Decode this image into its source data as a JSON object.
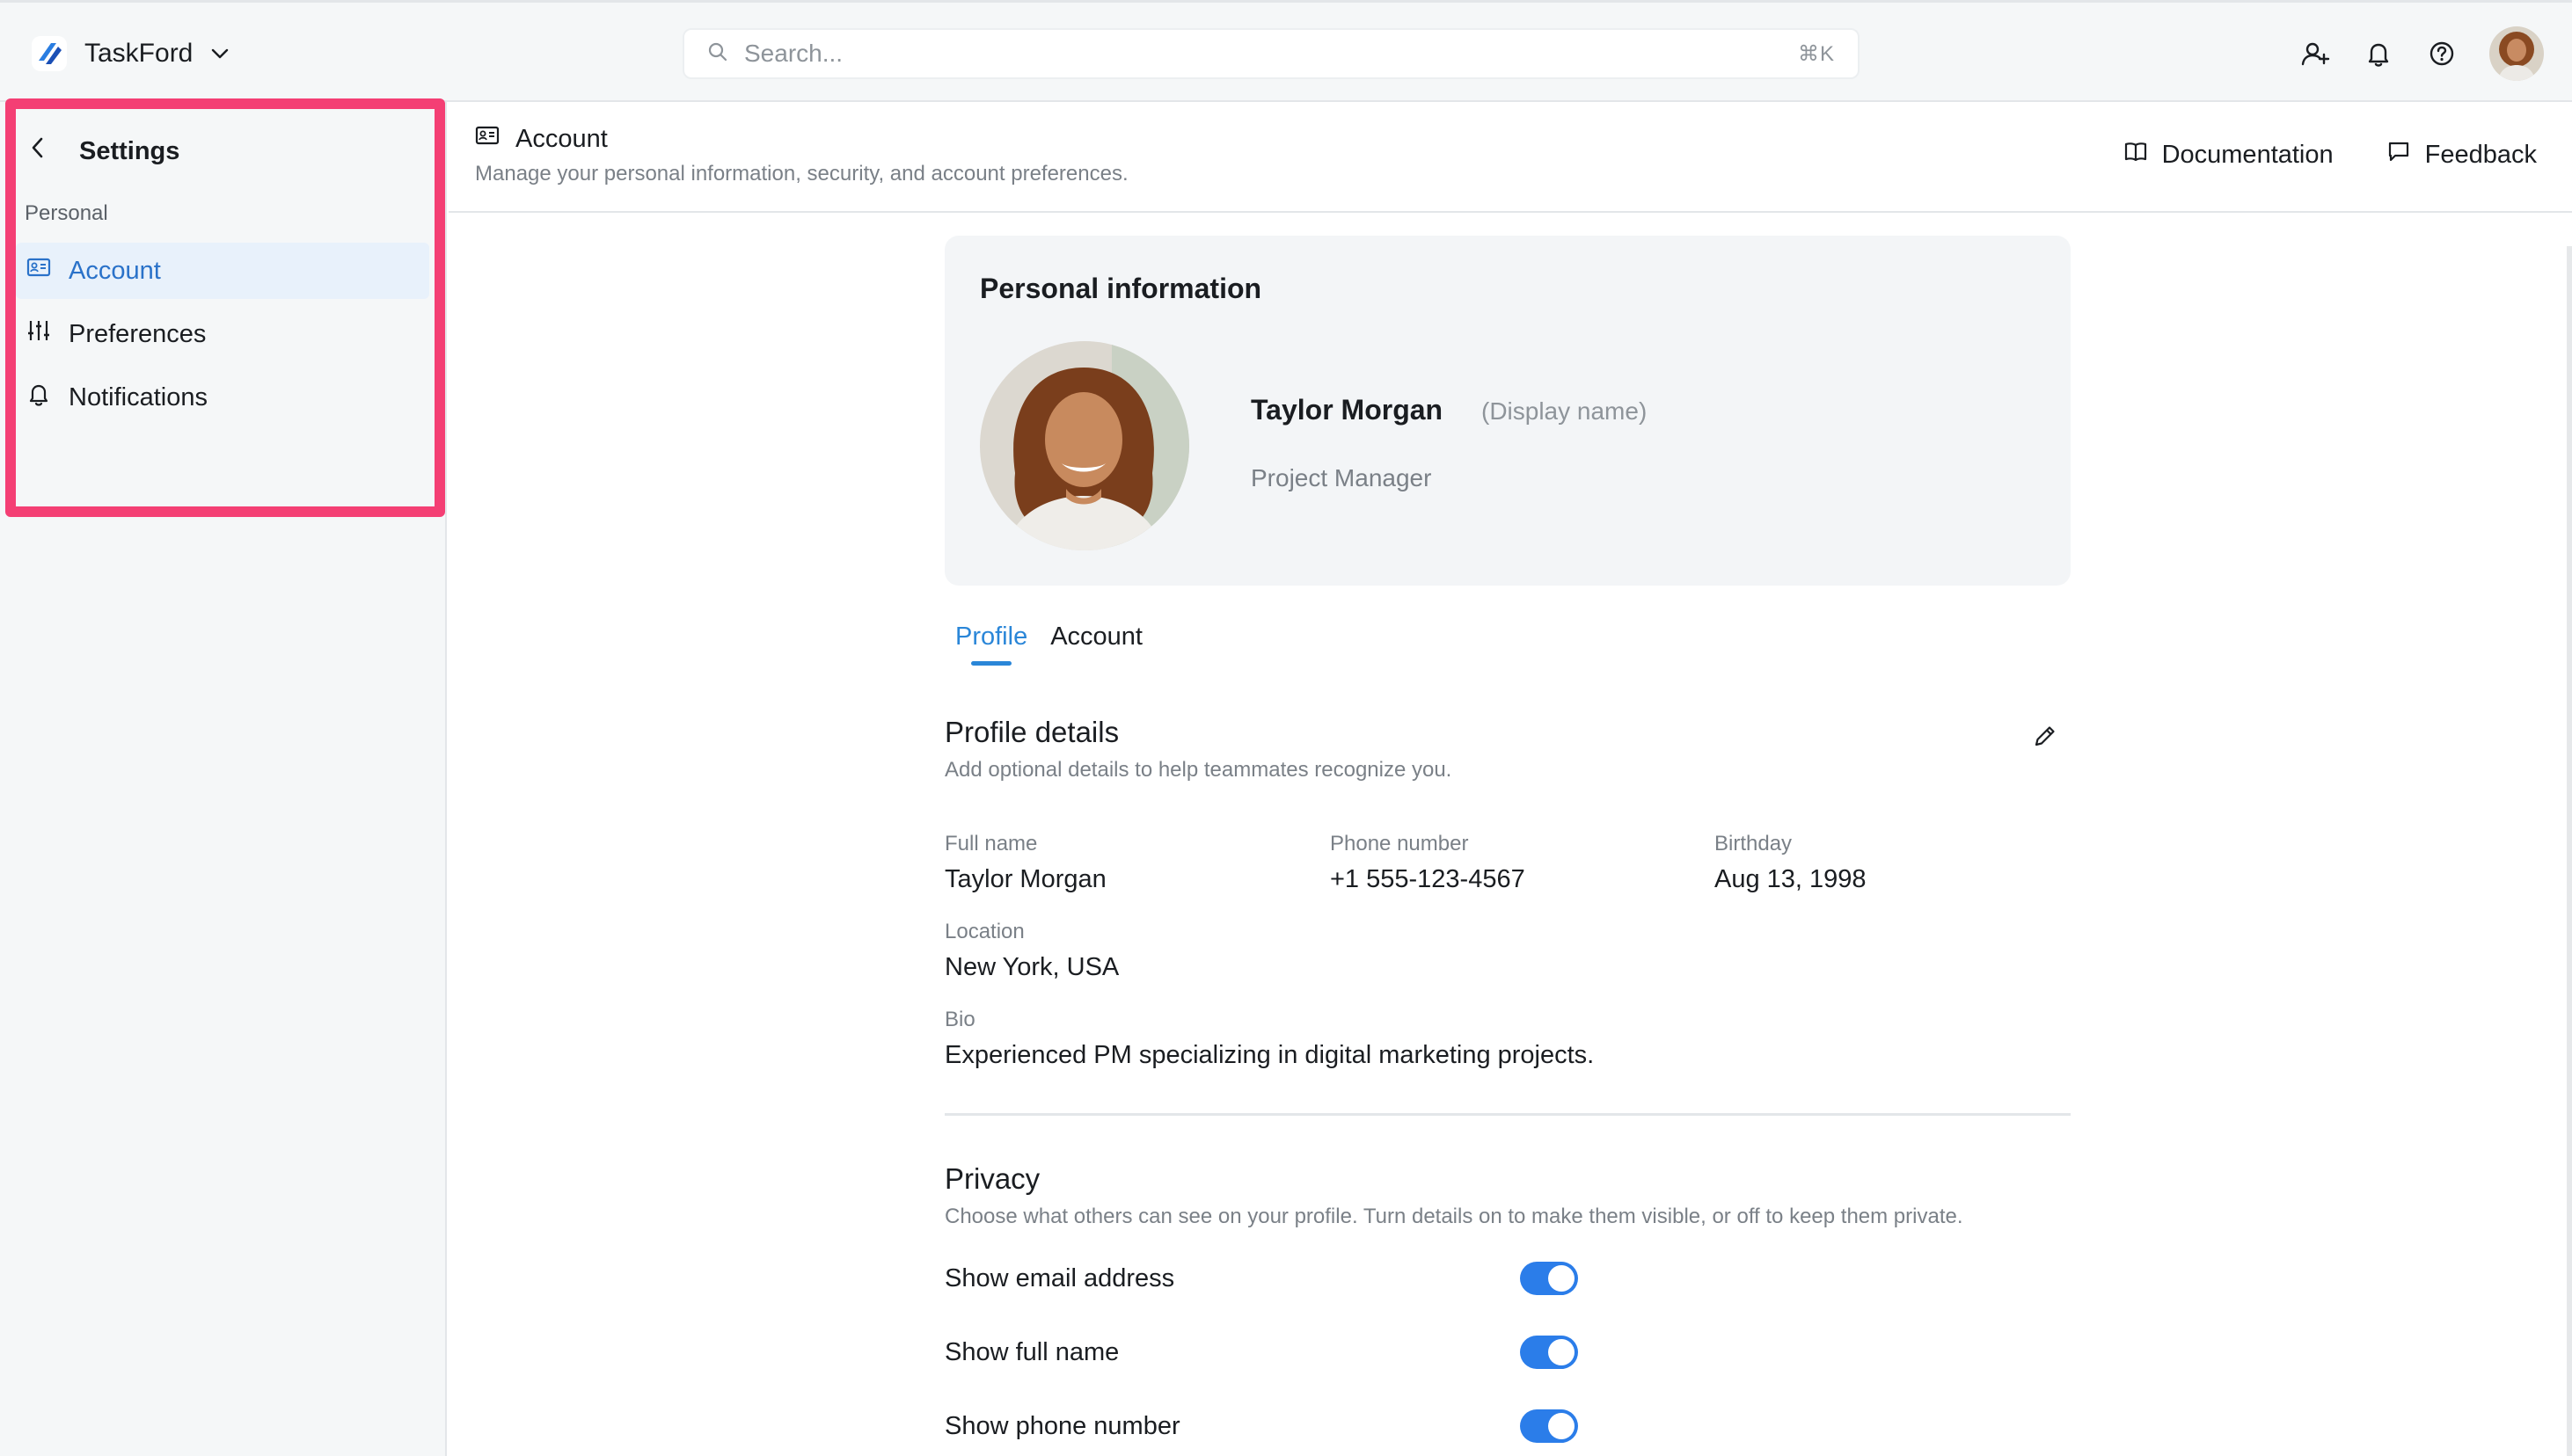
{
  "app": {
    "name": "TaskFord"
  },
  "search": {
    "placeholder": "Search...",
    "shortcut": "⌘K"
  },
  "topbar": {
    "icons": [
      "add-user-icon",
      "bell-icon",
      "help-icon",
      "avatar"
    ]
  },
  "sidebar": {
    "title": "Settings",
    "section": "Personal",
    "items": [
      {
        "label": "Account",
        "icon": "id-card-icon",
        "active": true
      },
      {
        "label": "Preferences",
        "icon": "sliders-icon",
        "active": false
      },
      {
        "label": "Notifications",
        "icon": "bell-icon",
        "active": false
      }
    ]
  },
  "page": {
    "title": "Account",
    "subtitle": "Manage your personal information, security, and account preferences.",
    "documentation": "Documentation",
    "feedback": "Feedback"
  },
  "personal_info": {
    "title": "Personal information",
    "name": "Taylor Morgan",
    "display_hint": "(Display name)",
    "role": "Project Manager"
  },
  "tabs": [
    {
      "label": "Profile",
      "active": true
    },
    {
      "label": "Account",
      "active": false
    }
  ],
  "profile_details": {
    "title": "Profile details",
    "subtitle": "Add optional details to help teammates recognize you.",
    "fields": {
      "full_name": {
        "label": "Full name",
        "value": "Taylor Morgan"
      },
      "phone": {
        "label": "Phone number",
        "value": "+1 555-123-4567"
      },
      "birthday": {
        "label": "Birthday",
        "value": "Aug 13, 1998"
      },
      "location": {
        "label": "Location",
        "value": "New York, USA"
      },
      "bio": {
        "label": "Bio",
        "value": "Experienced PM specializing in digital marketing projects."
      }
    }
  },
  "privacy": {
    "title": "Privacy",
    "subtitle": "Choose what others can see on your profile. Turn details on to make them visible, or off to keep them private.",
    "toggles": [
      {
        "label": "Show email address",
        "on": true
      },
      {
        "label": "Show full name",
        "on": true
      },
      {
        "label": "Show phone number",
        "on": true
      }
    ]
  },
  "colors": {
    "accent": "#2a86d8",
    "toggle_on": "#2b7de9",
    "highlight": "#f43f74",
    "active_bg": "#e8f1fb"
  }
}
